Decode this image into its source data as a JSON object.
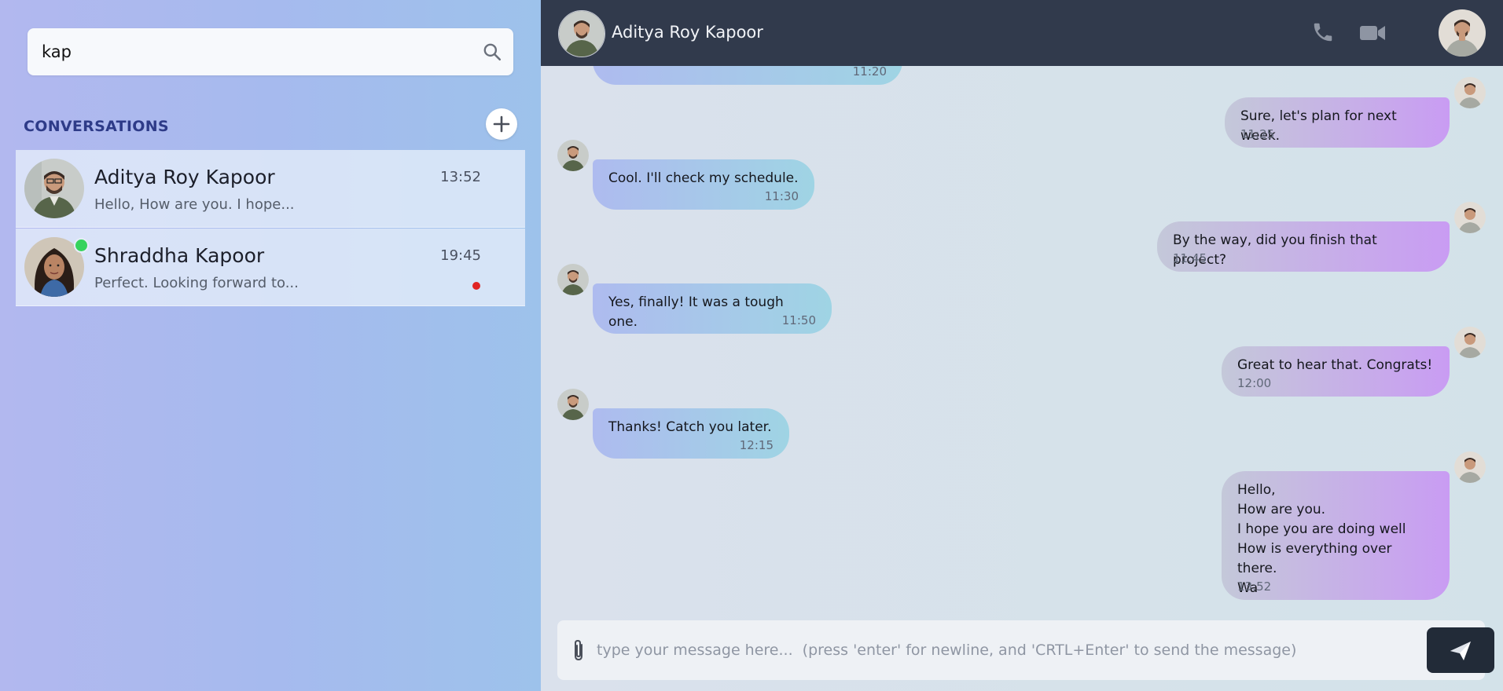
{
  "search": {
    "value": "kap",
    "icon": "search-icon"
  },
  "sidebar": {
    "section_title": "CONVERSATIONS",
    "add_icon": "plus-icon",
    "conversations": [
      {
        "name": "Aditya Roy Kapoor",
        "preview": "Hello, How are you. I hope...",
        "time": "13:52",
        "online": false,
        "unread": false
      },
      {
        "name": "Shraddha Kapoor",
        "preview": "Perfect. Looking forward to...",
        "time": "19:45",
        "online": true,
        "unread": true
      }
    ]
  },
  "chat": {
    "contact_name": "Aditya Roy Kapoor",
    "phone_icon": "phone-icon",
    "video_icon": "video-camera-icon",
    "messages": [
      {
        "direction": "in",
        "text": "",
        "time": "11:20"
      },
      {
        "direction": "out",
        "text": "Sure, let's plan for next week.",
        "time": "11:25"
      },
      {
        "direction": "in",
        "text": "Cool. I'll check my schedule.",
        "time": "11:30"
      },
      {
        "direction": "out",
        "text": "By the way, did you finish that project?",
        "time": "11:45"
      },
      {
        "direction": "in",
        "text": "Yes, finally! It was a tough one.",
        "time": "11:50"
      },
      {
        "direction": "out",
        "text": "Great to hear that. Congrats!",
        "time": "12:00"
      },
      {
        "direction": "in",
        "text": "Thanks! Catch you later.",
        "time": "12:15"
      },
      {
        "direction": "out",
        "text": "Hello,\nHow are you.\nI hope you are doing well\nHow is everything over there.\nWa",
        "time": "13:52"
      }
    ]
  },
  "composer": {
    "placeholder": "type your message here...  (press 'enter' for newline, and 'CRTL+Enter' to send the message)",
    "attach_icon": "paperclip-icon",
    "send_icon": "send-icon"
  },
  "colors": {
    "topbar": "#313a4c",
    "accent_title": "#2e3b88",
    "online": "#36d35d",
    "unread": "#e02323",
    "send_button": "#222b38"
  }
}
